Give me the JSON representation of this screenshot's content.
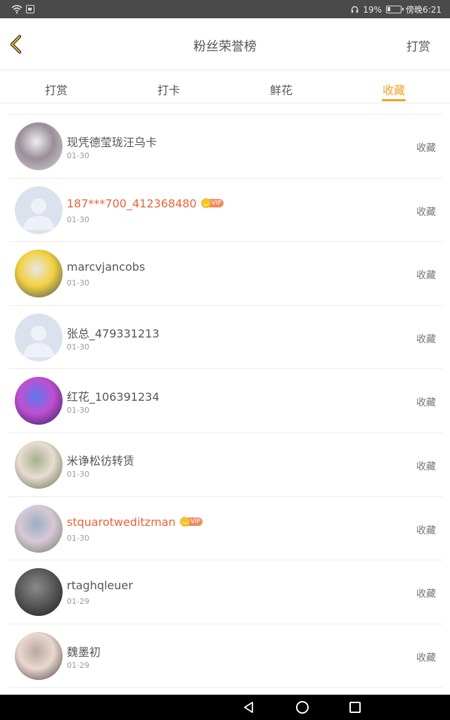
{
  "status_bar": {
    "battery": "19%",
    "time": "傍晚6:21",
    "battery_fraction": 0.19
  },
  "header": {
    "title": "粉丝荣誉榜",
    "action_label": "打赏"
  },
  "tabs": [
    {
      "label": "打赏",
      "active": false
    },
    {
      "label": "打卡",
      "active": false
    },
    {
      "label": "鲜花",
      "active": false
    },
    {
      "label": "收藏",
      "active": true
    }
  ],
  "list": {
    "items": [
      {
        "name": "现凭德莹珑汪乌卡",
        "date": "01-30",
        "action": "收藏",
        "vip": false,
        "avatar_colors": [
          "#d8d4dc",
          "#9a8f99",
          "#f0eef2"
        ]
      },
      {
        "name": "187***700_412368480",
        "date": "01-30",
        "action": "收藏",
        "vip": true,
        "vip_label": "VIP",
        "avatar_colors": [
          "#dbe2ee",
          "#c3cde0",
          "#eef2f8"
        ]
      },
      {
        "name": "marcvjancobs",
        "date": "01-30",
        "action": "收藏",
        "vip": false,
        "avatar_colors": [
          "#3a4a5a",
          "#f3d040",
          "#e8e8e8"
        ]
      },
      {
        "name": "张总_479331213",
        "date": "01-30",
        "action": "收藏",
        "vip": false,
        "avatar_colors": [
          "#dbe2ee",
          "#c3cde0",
          "#eef2f8"
        ]
      },
      {
        "name": "红花_106391234",
        "date": "01-30",
        "action": "收藏",
        "vip": false,
        "avatar_colors": [
          "#2a1a5a",
          "#c050d0",
          "#5a7af0"
        ]
      },
      {
        "name": "米诤松彷转赁",
        "date": "01-30",
        "action": "收藏",
        "vip": false,
        "avatar_colors": [
          "#5a6a4a",
          "#e8dcd0",
          "#a8b090"
        ]
      },
      {
        "name": "stquarotweditzman",
        "date": "01-30",
        "action": "收藏",
        "vip": true,
        "vip_label": "VIP",
        "avatar_colors": [
          "#6a7a5a",
          "#d8c8d8",
          "#9ab0c0"
        ]
      },
      {
        "name": "rtaghqleuer",
        "date": "01-29",
        "action": "收藏",
        "vip": false,
        "avatar_colors": [
          "#1a1a1a",
          "#5a5a5a",
          "#8a8a8a"
        ]
      },
      {
        "name": "魏墨初",
        "date": "01-29",
        "action": "收藏",
        "vip": false,
        "avatar_colors": [
          "#4a3a38",
          "#e8d8d0",
          "#b8a8a0"
        ]
      }
    ]
  }
}
